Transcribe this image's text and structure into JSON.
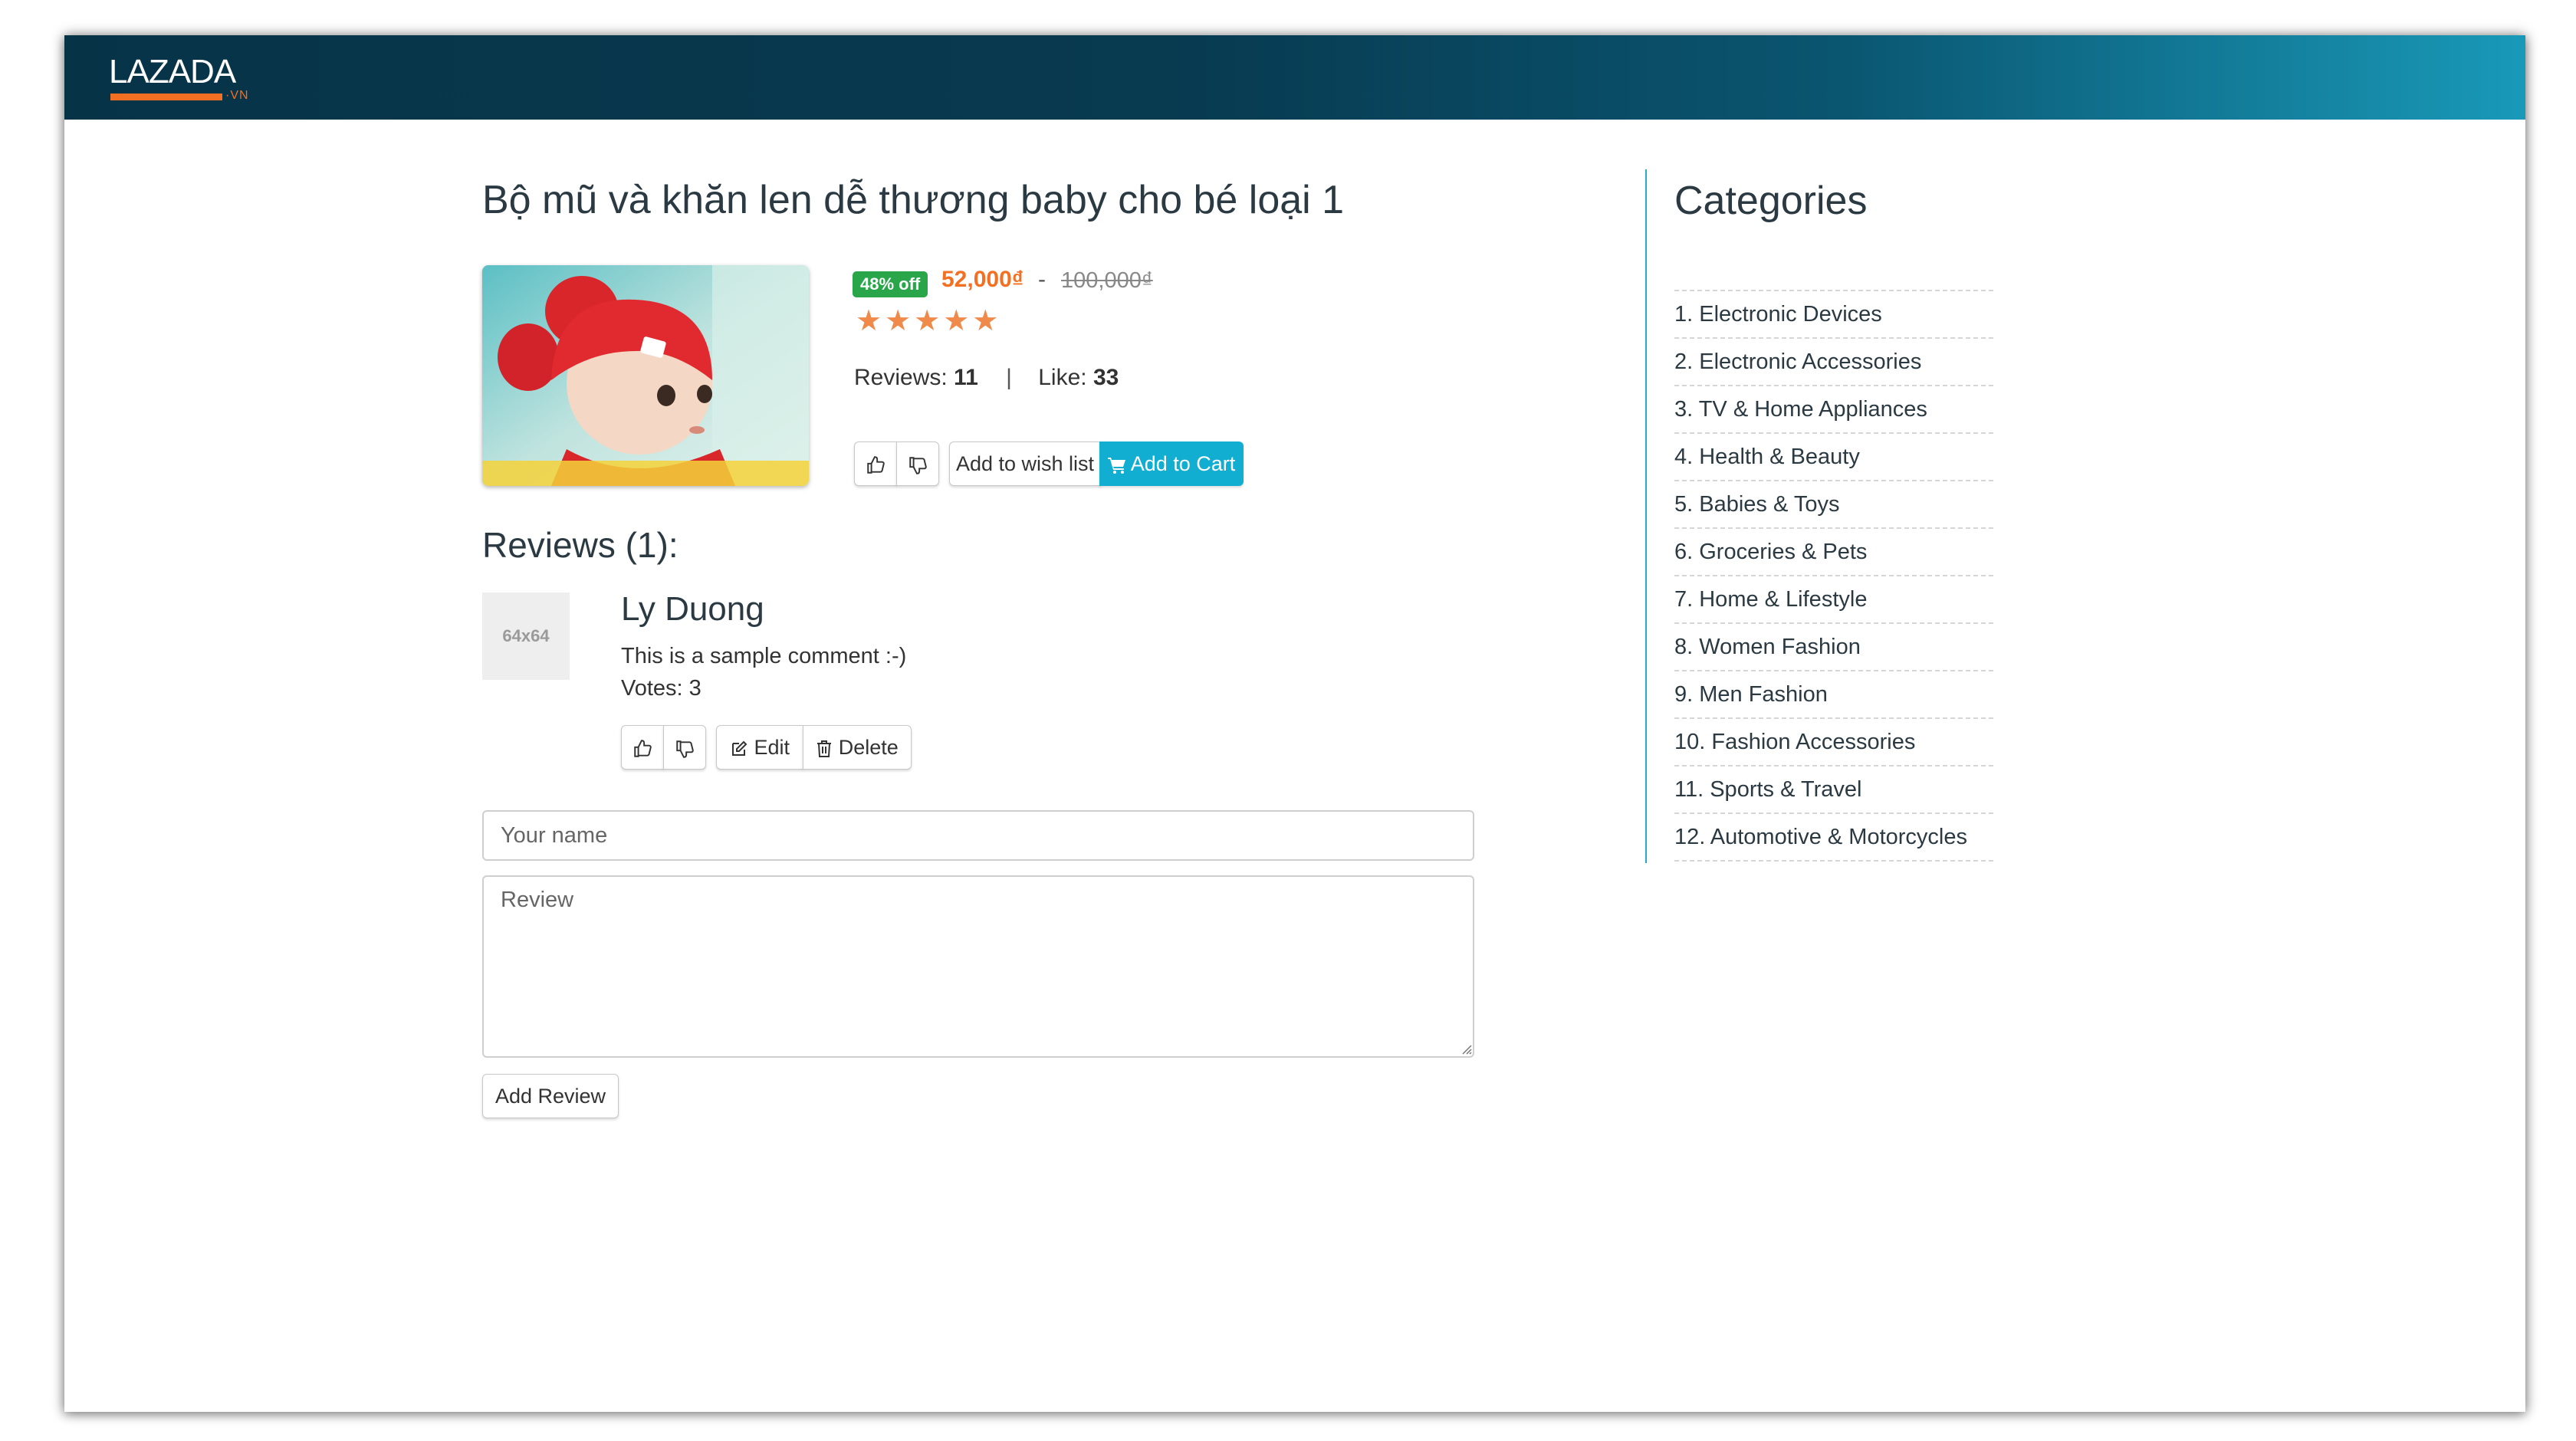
{
  "header": {
    "logo_text": "LAZADA",
    "logo_sub": "·VN",
    "logo_color": "#f36f21",
    "bar_color_start": "#073347",
    "bar_color_end": "#1999b8"
  },
  "product": {
    "title": "Bộ mũ và khăn len dễ thương baby cho bé loại 1",
    "discount_badge": "48% off",
    "price": "52,000₫",
    "price_separator": "-",
    "old_price": "100,000₫",
    "rating_stars": 5,
    "stars_text": "★★★★★",
    "reviews_label": "Reviews:",
    "reviews_count": "11",
    "stats_separator": "|",
    "like_label": "Like:",
    "like_count": "33",
    "add_wishlist_label": "Add to wish list",
    "add_cart_label": "Add to Cart",
    "accent_color": "#12aed1"
  },
  "reviews": {
    "heading": "Reviews (1):",
    "items": [
      {
        "avatar_text": "64x64",
        "name": "Ly Duong",
        "comment": "This is a sample comment :-)",
        "votes_label": "Votes: 3",
        "edit_label": "Edit",
        "delete_label": "Delete"
      }
    ]
  },
  "review_form": {
    "name_placeholder": "Your name",
    "review_placeholder": "Review",
    "submit_label": "Add Review"
  },
  "sidebar": {
    "title": "Categories",
    "items": [
      {
        "label": "1. Electronic Devices"
      },
      {
        "label": "2. Electronic Accessories"
      },
      {
        "label": "3. TV & Home Appliances"
      },
      {
        "label": "4. Health & Beauty"
      },
      {
        "label": "5. Babies & Toys"
      },
      {
        "label": "6. Groceries & Pets"
      },
      {
        "label": "7. Home & Lifestyle"
      },
      {
        "label": "8. Women Fashion"
      },
      {
        "label": "9. Men Fashion"
      },
      {
        "label": "10. Fashion Accessories"
      },
      {
        "label": "11. Sports & Travel"
      },
      {
        "label": "12. Automotive & Motorcycles"
      }
    ]
  }
}
